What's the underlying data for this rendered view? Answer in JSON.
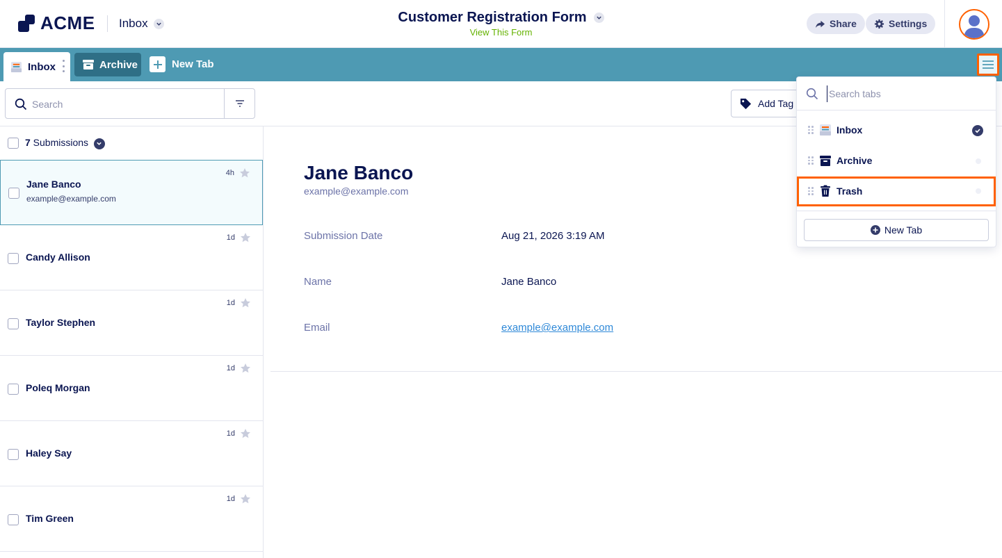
{
  "header": {
    "logo_text": "ACME",
    "inbox_switch_label": "Inbox",
    "form_title": "Customer Registration Form",
    "view_form_link": "View This Form",
    "share_label": "Share",
    "settings_label": "Settings"
  },
  "tabs": {
    "inbox_label": "Inbox",
    "archive_label": "Archive",
    "new_tab_label": "New Tab"
  },
  "toolbar": {
    "search_placeholder": "Search",
    "add_tag_label": "Add Tag"
  },
  "list": {
    "count": "7",
    "count_suffix": " Submissions",
    "rows": [
      {
        "name": "Jane Banco",
        "email": "example@example.com",
        "time": "4h"
      },
      {
        "name": "Candy Allison",
        "time": "1d"
      },
      {
        "name": "Taylor Stephen",
        "time": "1d"
      },
      {
        "name": "Poleq Morgan",
        "time": "1d"
      },
      {
        "name": "Haley Say",
        "time": "1d"
      },
      {
        "name": "Tim Green",
        "time": "1d"
      }
    ]
  },
  "detail": {
    "name": "Jane Banco",
    "email": "example@example.com",
    "fields": [
      {
        "label": "Submission Date",
        "value": "Aug 21, 2026 3:19 AM"
      },
      {
        "label": "Name",
        "value": "Jane Banco"
      },
      {
        "label": "Email",
        "value": "example@example.com"
      }
    ]
  },
  "dropdown": {
    "search_placeholder": "Search tabs",
    "items": [
      {
        "label": "Inbox",
        "icon": "inbox-icon",
        "selected": true
      },
      {
        "label": "Archive",
        "icon": "archive-icon",
        "selected": false
      },
      {
        "label": "Trash",
        "icon": "trash-icon",
        "selected": false
      }
    ],
    "new_tab_label": "New Tab"
  },
  "colors": {
    "navy": "#0a1551",
    "tabbar": "#4e9ab3",
    "archive_tab": "#2f6f86",
    "highlight": "#ff6100",
    "link_green": "#64b200",
    "link_blue": "#2f89d8"
  }
}
